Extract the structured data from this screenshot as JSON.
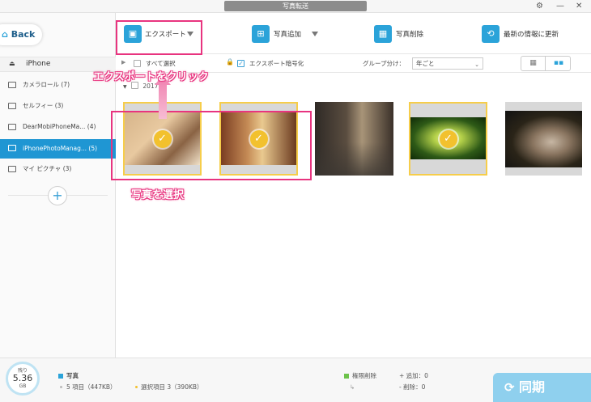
{
  "window": {
    "title": "写真転送",
    "gear": "⚙",
    "minimize": "—",
    "close": "✕"
  },
  "sidebar": {
    "back_label": "Back",
    "device": "iPhone",
    "device_icon": "⏏",
    "items": [
      {
        "label": "カメラロール (7)"
      },
      {
        "label": "セルフィー (3)"
      },
      {
        "label": "DearMobiPhoneMa... (4)"
      },
      {
        "label": "iPhonePhotoManag... (5)"
      },
      {
        "label": "マイ ピクチャ (3)"
      }
    ],
    "add_label": "+"
  },
  "toolbar": {
    "export": "エクスポート",
    "add_photo": "写真追加",
    "delete_photo": "写真削除",
    "refresh": "最新の情報に更新",
    "export_icon": "▣",
    "add_icon": "⊞",
    "delete_icon": "▦",
    "refresh_icon": "⟲"
  },
  "options": {
    "select_all": "すべて選択",
    "encrypt": "エクスポート暗号化",
    "encrypt_check": "✓",
    "lock_icon": "🔒",
    "group_label": "グループ分け：",
    "group_value": "年ごと",
    "group_caret": "⌄",
    "view_grid": "▦",
    "view_small": "▪▪"
  },
  "group_header": {
    "expand": "▼",
    "label": "2017(5)"
  },
  "photos": [
    {
      "name": "cat",
      "selected": true
    },
    {
      "name": "piano",
      "selected": true
    },
    {
      "name": "street",
      "selected": false
    },
    {
      "name": "forest",
      "selected": true
    },
    {
      "name": "squirrel",
      "selected": false
    }
  ],
  "tick": "✓",
  "annotations": {
    "click_export": "エクスポートをクリック",
    "select_photos": "写真を選択"
  },
  "bottom": {
    "storage_label": "残り",
    "storage_value": "5.36",
    "storage_unit": "GB",
    "category": "写真",
    "items": "5 項目（447KB）",
    "selected_items": "選択項目 3（390KB）",
    "privilege_delete": "権限削除",
    "arrow": "↳",
    "added": "+ 追加：0",
    "removed": "- 削除：0",
    "sync": "同期",
    "sync_icon": "⟳"
  },
  "colors": {
    "accent": "#2ba3d9",
    "selected_sidebar": "#1f96d3",
    "selection_border": "#f6cd4a",
    "annotation": "#e8347f",
    "sync_button": "#8fd0ee"
  }
}
